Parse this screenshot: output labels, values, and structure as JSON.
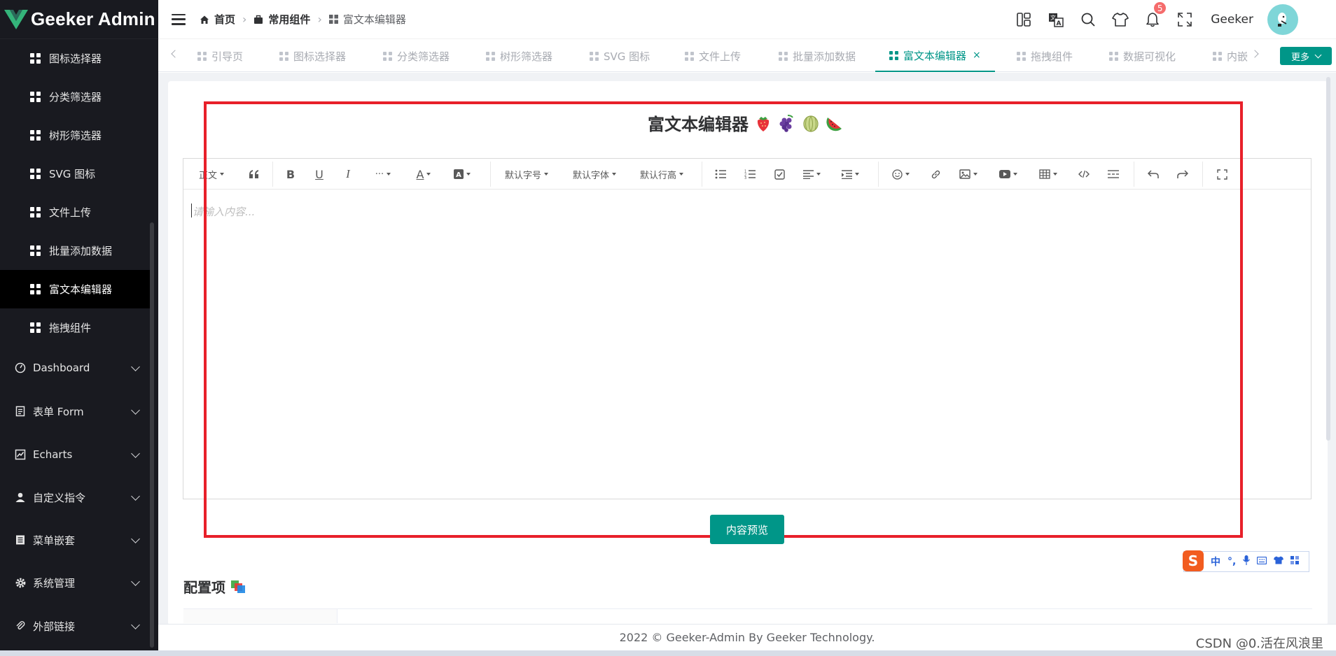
{
  "app": {
    "logo_text": "Geeker Admin"
  },
  "sidebar": {
    "sub_items": [
      {
        "label": "图标选择器",
        "active": false
      },
      {
        "label": "分类筛选器",
        "active": false
      },
      {
        "label": "树形筛选器",
        "active": false
      },
      {
        "label": "SVG 图标",
        "active": false
      },
      {
        "label": "文件上传",
        "active": false
      },
      {
        "label": "批量添加数据",
        "active": false
      },
      {
        "label": "富文本编辑器",
        "active": true
      },
      {
        "label": "拖拽组件",
        "active": false
      }
    ],
    "groups": [
      {
        "label": "Dashboard",
        "icon": "dashboard-icon"
      },
      {
        "label": "表单 Form",
        "icon": "form-icon"
      },
      {
        "label": "Echarts",
        "icon": "chart-icon"
      },
      {
        "label": "自定义指令",
        "icon": "user-icon"
      },
      {
        "label": "菜单嵌套",
        "icon": "menu-icon"
      },
      {
        "label": "系统管理",
        "icon": "gear-icon"
      },
      {
        "label": "外部链接",
        "icon": "paperclip-icon"
      }
    ]
  },
  "header": {
    "breadcrumbs": [
      {
        "label": "首页",
        "icon": "home-icon"
      },
      {
        "label": "常用组件",
        "icon": "briefcase-icon"
      },
      {
        "label": "富文本编辑器",
        "icon": "grid-icon"
      }
    ],
    "notification_count": "5",
    "username": "Geeker"
  },
  "tabs": {
    "items": [
      {
        "label": "引导页",
        "active": false
      },
      {
        "label": "图标选择器",
        "active": false
      },
      {
        "label": "分类筛选器",
        "active": false
      },
      {
        "label": "树形筛选器",
        "active": false
      },
      {
        "label": "SVG 图标",
        "active": false
      },
      {
        "label": "文件上传",
        "active": false
      },
      {
        "label": "批量添加数据",
        "active": false
      },
      {
        "label": "富文本编辑器",
        "active": true
      },
      {
        "label": "拖拽组件",
        "active": false
      },
      {
        "label": "数据可视化",
        "active": false
      },
      {
        "label": "内嵌",
        "active": false
      }
    ],
    "more_label": "更多",
    "close_symbol": "×"
  },
  "editor": {
    "title": "富文本编辑器",
    "title_emojis": [
      "strawberry",
      "grapes",
      "melon",
      "watermelon"
    ],
    "toolbar": {
      "heading_label": "正文",
      "font_size_label": "默认字号",
      "font_family_label": "默认字体",
      "line_height_label": "默认行高",
      "more_label": "···"
    },
    "placeholder": "请输入内容..."
  },
  "preview_button": "内容预览",
  "config": {
    "title": "配置项"
  },
  "ime": {
    "logo": "S",
    "mode": "中",
    "punct": "°,"
  },
  "footer": {
    "text": "2022 © Geeker-Admin By Geeker Technology."
  },
  "watermark": "CSDN @0.活在风浪里",
  "colors": {
    "accent": "#009688",
    "sidebar_bg": "#191a20",
    "highlight_box": "#e8202a",
    "badge": "#f56c6c"
  }
}
